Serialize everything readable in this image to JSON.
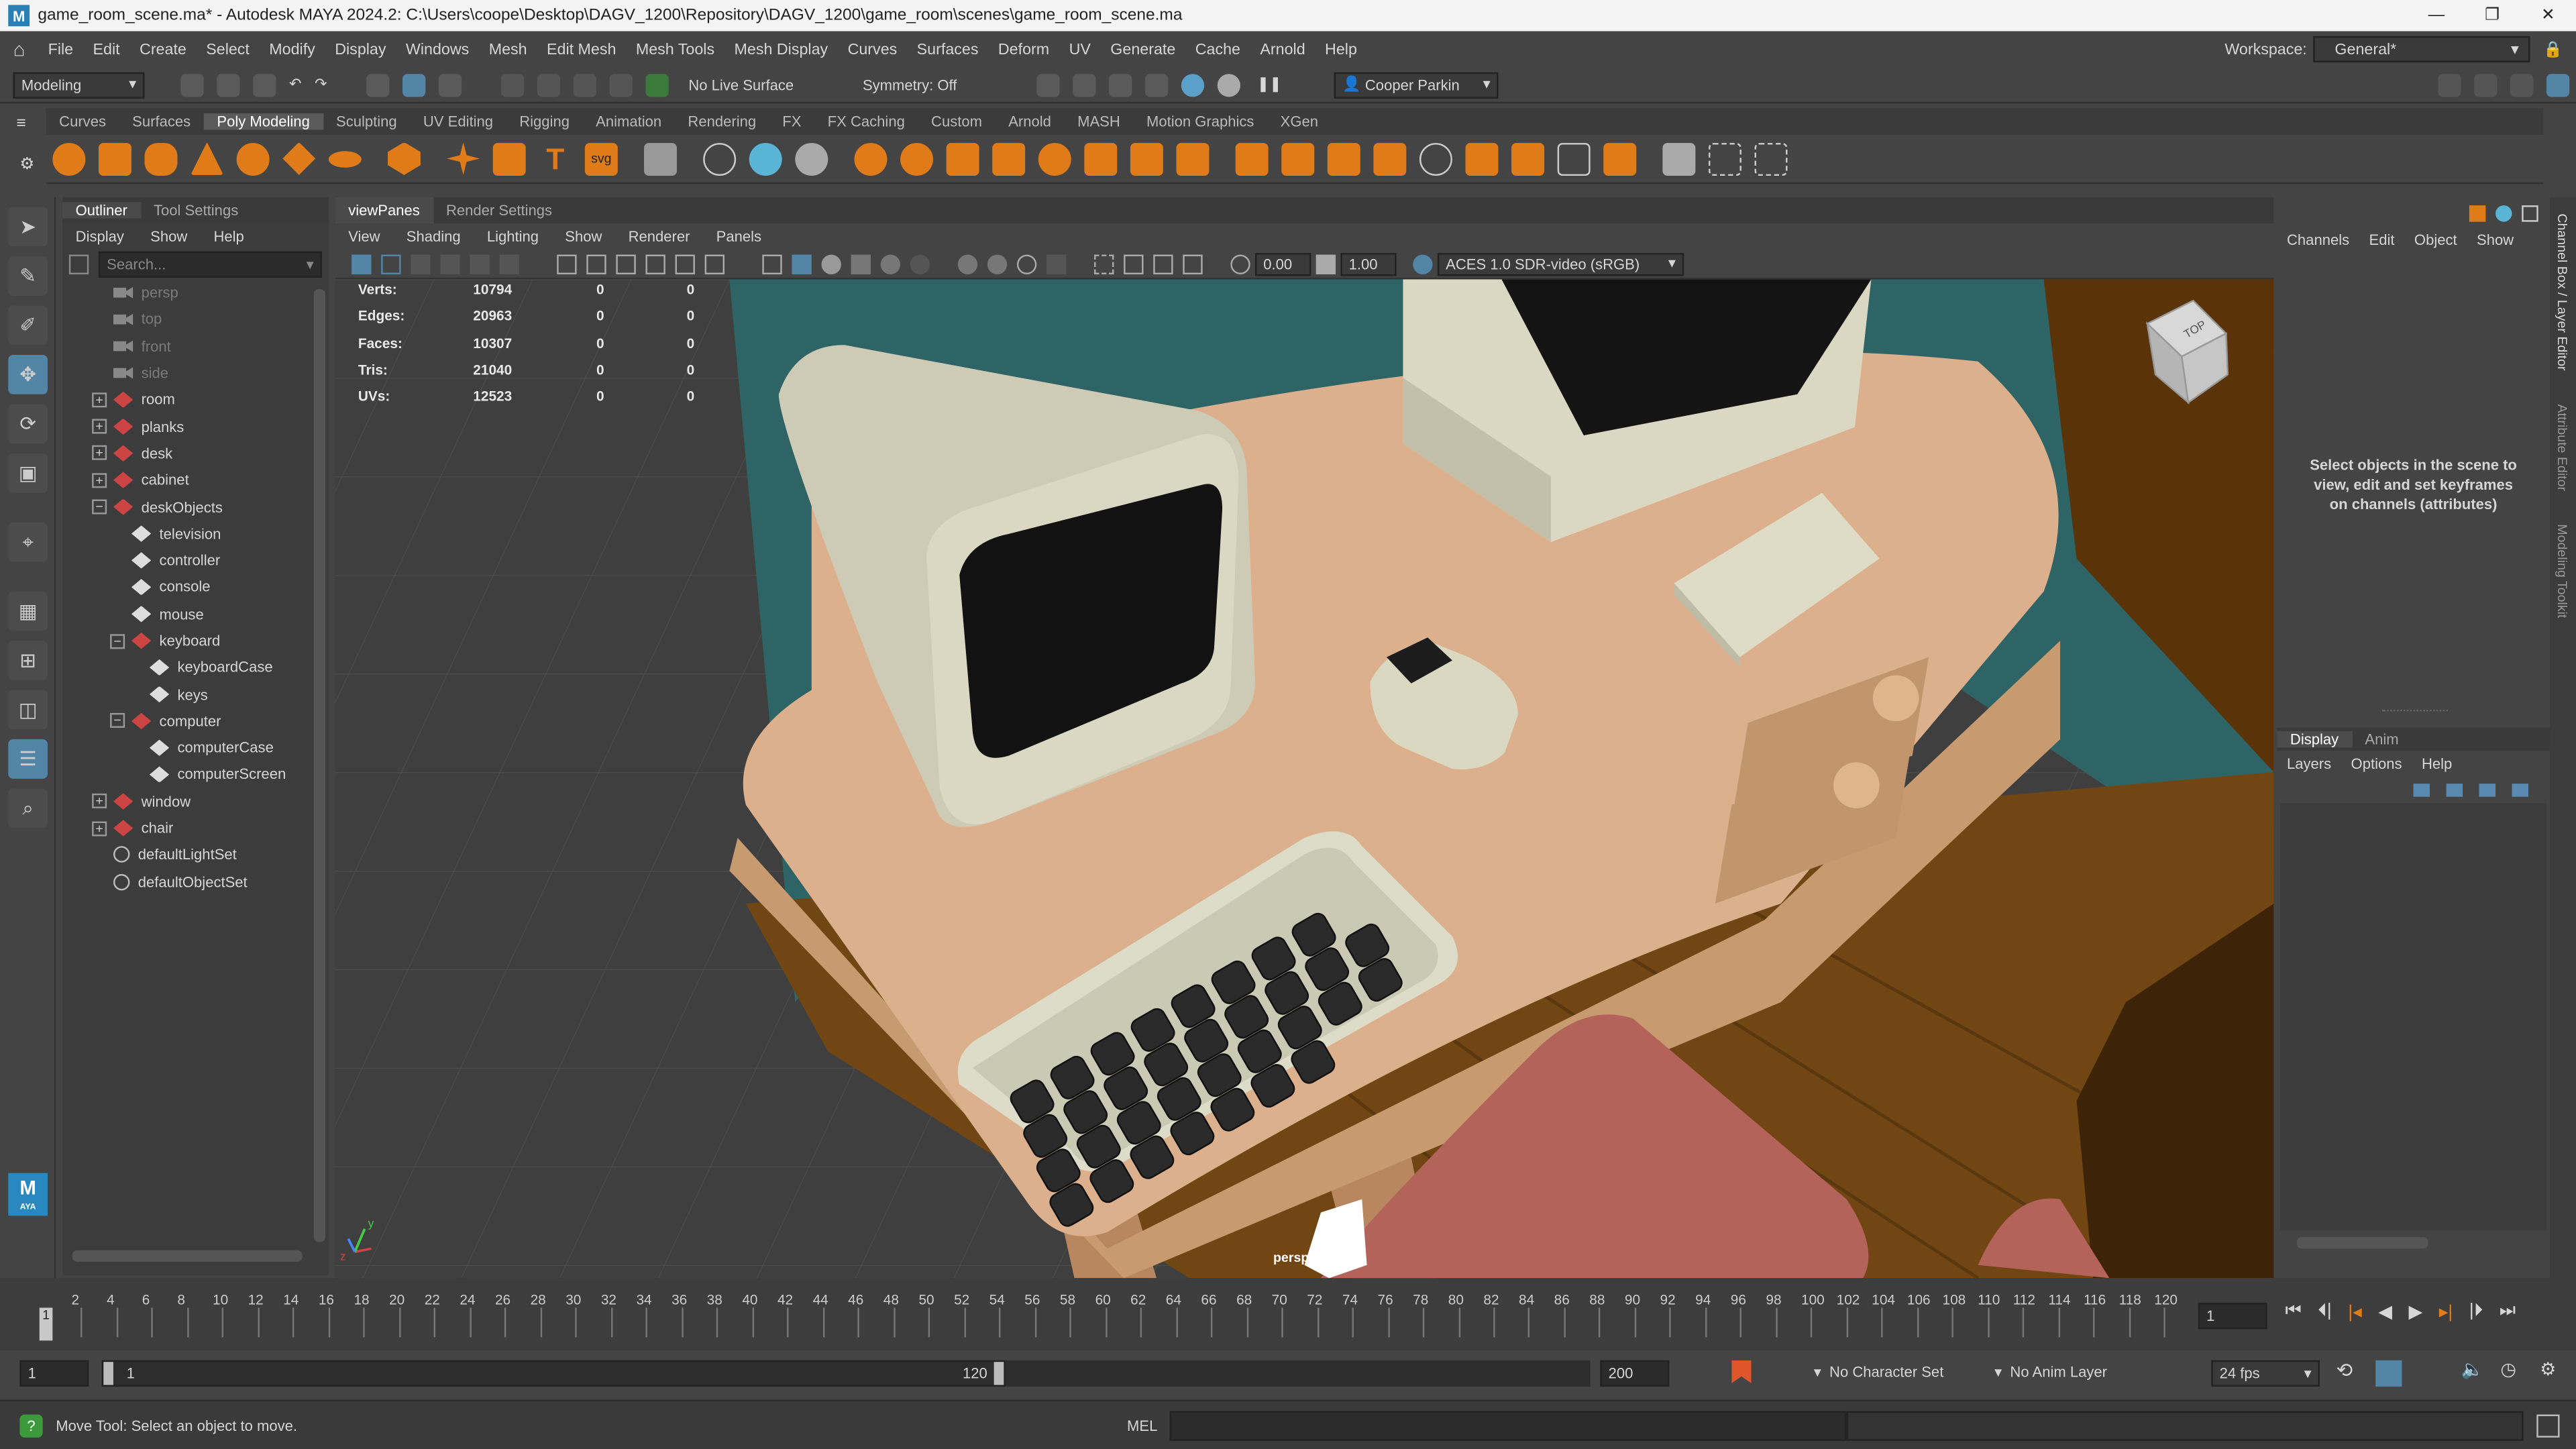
{
  "window": {
    "title": "game_room_scene.ma* - Autodesk MAYA 2024.2: C:\\Users\\coope\\Desktop\\DAGV_1200\\Repository\\DAGV_1200\\game_room\\scenes\\game_room_scene.ma",
    "app_icon": "M"
  },
  "menu": [
    "File",
    "Edit",
    "Create",
    "Select",
    "Modify",
    "Display",
    "Windows",
    "Mesh",
    "Edit Mesh",
    "Mesh Tools",
    "Mesh Display",
    "Curves",
    "Surfaces",
    "Deform",
    "UV",
    "Generate",
    "Cache",
    "Arnold",
    "Help"
  ],
  "workspace": {
    "label": "Workspace:",
    "value": "General*"
  },
  "status": {
    "mode": "Modeling",
    "live": "No Live Surface",
    "symmetry": "Symmetry: Off",
    "user": "Cooper Parkin"
  },
  "shelf_tabs": [
    "Curves",
    "Surfaces",
    "Poly Modeling",
    "Sculpting",
    "UV Editing",
    "Rigging",
    "Animation",
    "Rendering",
    "FX",
    "FX Caching",
    "Custom",
    "Arnold",
    "MASH",
    "Motion Graphics",
    "XGen"
  ],
  "shelf_active": "Poly Modeling",
  "outliner": {
    "tabs": [
      "Outliner",
      "Tool Settings"
    ],
    "menu": [
      "Display",
      "Show",
      "Help"
    ],
    "search": "Search...",
    "items": [
      {
        "label": "persp",
        "kind": "cam",
        "depth": 0,
        "exp": "",
        "dim": true
      },
      {
        "label": "top",
        "kind": "cam",
        "depth": 0,
        "exp": "",
        "dim": true
      },
      {
        "label": "front",
        "kind": "cam",
        "depth": 0,
        "exp": "",
        "dim": true
      },
      {
        "label": "side",
        "kind": "cam",
        "depth": 0,
        "exp": "",
        "dim": true
      },
      {
        "label": "room",
        "kind": "grp",
        "depth": 0,
        "exp": "+"
      },
      {
        "label": "planks",
        "kind": "grp",
        "depth": 0,
        "exp": "+"
      },
      {
        "label": "desk",
        "kind": "grp",
        "depth": 0,
        "exp": "+"
      },
      {
        "label": "cabinet",
        "kind": "grp",
        "depth": 0,
        "exp": "+"
      },
      {
        "label": "deskObjects",
        "kind": "grp",
        "depth": 0,
        "exp": "−"
      },
      {
        "label": "television",
        "kind": "msh",
        "depth": 1,
        "exp": ""
      },
      {
        "label": "controller",
        "kind": "msh",
        "depth": 1,
        "exp": ""
      },
      {
        "label": "console",
        "kind": "msh",
        "depth": 1,
        "exp": ""
      },
      {
        "label": "mouse",
        "kind": "msh",
        "depth": 1,
        "exp": ""
      },
      {
        "label": "keyboard",
        "kind": "grp",
        "depth": 1,
        "exp": "−"
      },
      {
        "label": "keyboardCase",
        "kind": "msh",
        "depth": 2,
        "exp": ""
      },
      {
        "label": "keys",
        "kind": "msh",
        "depth": 2,
        "exp": ""
      },
      {
        "label": "computer",
        "kind": "grp",
        "depth": 1,
        "exp": "−"
      },
      {
        "label": "computerCase",
        "kind": "msh",
        "depth": 2,
        "exp": ""
      },
      {
        "label": "computerScreen",
        "kind": "msh",
        "depth": 2,
        "exp": ""
      },
      {
        "label": "window",
        "kind": "grp",
        "depth": 0,
        "exp": "+"
      },
      {
        "label": "chair",
        "kind": "grp",
        "depth": 0,
        "exp": "+"
      },
      {
        "label": "defaultLightSet",
        "kind": "set",
        "depth": 0,
        "exp": ""
      },
      {
        "label": "defaultObjectSet",
        "kind": "set",
        "depth": 0,
        "exp": ""
      }
    ]
  },
  "viewport": {
    "tabs": [
      "viewPanes",
      "Render Settings"
    ],
    "menu": [
      "View",
      "Shading",
      "Lighting",
      "Show",
      "Renderer",
      "Panels"
    ],
    "exposure": "0.00",
    "gamma": "1.00",
    "colorspace": "ACES 1.0 SDR-video (sRGB)",
    "camera": "persp",
    "viewcube": "TOP",
    "hud": [
      {
        "label": "Verts:",
        "a": "10794",
        "b": "0",
        "c": "0"
      },
      {
        "label": "Edges:",
        "a": "20963",
        "b": "0",
        "c": "0"
      },
      {
        "label": "Faces:",
        "a": "10307",
        "b": "0",
        "c": "0"
      },
      {
        "label": "Tris:",
        "a": "21040",
        "b": "0",
        "c": "0"
      },
      {
        "label": "UVs:",
        "a": "12523",
        "b": "0",
        "c": "0"
      }
    ]
  },
  "channel": {
    "menu": [
      "Channels",
      "Edit",
      "Object",
      "Show"
    ],
    "message": "Select objects in the scene to view, edit and set keyframes on channels (attributes)",
    "layer_tabs": [
      "Display",
      "Anim"
    ],
    "layer_menu": [
      "Layers",
      "Options",
      "Help"
    ],
    "side_tabs": [
      "Channel Box / Layer Editor",
      "Attribute Editor",
      "Modeling Toolkit"
    ]
  },
  "timeline": {
    "ticks": [
      "2",
      "4",
      "6",
      "8",
      "10",
      "12",
      "14",
      "16",
      "18",
      "20",
      "22",
      "24",
      "26",
      "28",
      "30",
      "32",
      "34",
      "36",
      "38",
      "40",
      "42",
      "44",
      "46",
      "48",
      "50",
      "52",
      "54",
      "56",
      "58",
      "60",
      "62",
      "64",
      "66",
      "68",
      "70",
      "72",
      "74",
      "76",
      "78",
      "80",
      "82",
      "84",
      "86",
      "88",
      "90",
      "92",
      "94",
      "96",
      "98",
      "100",
      "102",
      "104",
      "106",
      "108",
      "110",
      "112",
      "114",
      "116",
      "118",
      "120"
    ],
    "current": "1",
    "marker": "1"
  },
  "range": {
    "start": "1",
    "inner_start": "1",
    "inner_end": "120",
    "end": "200",
    "char_set": "No Character Set",
    "anim_layer": "No Anim Layer",
    "fps": "24 fps"
  },
  "help": {
    "text": "Move Tool: Select an object to move.",
    "mel": "MEL"
  }
}
